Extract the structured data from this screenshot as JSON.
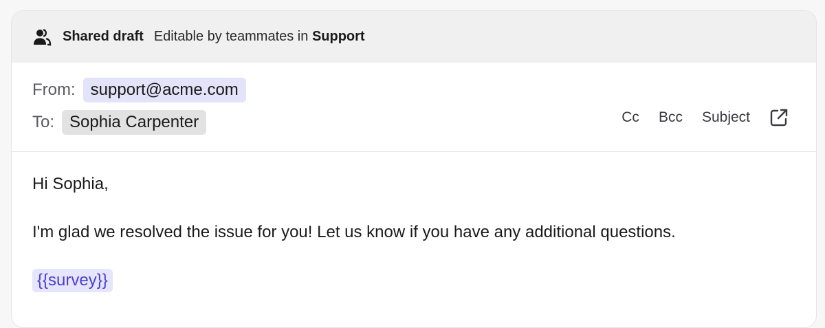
{
  "banner": {
    "title": "Shared draft",
    "description": "Editable by teammates in ",
    "team": "Support"
  },
  "header": {
    "from_label": "From:",
    "from_value": "support@acme.com",
    "to_label": "To:",
    "to_value": "Sophia Carpenter",
    "actions": {
      "cc": "Cc",
      "bcc": "Bcc",
      "subject": "Subject"
    }
  },
  "body": {
    "greeting": "Hi Sophia,",
    "message": "I'm glad we resolved the issue for you! Let us know if you have any additional questions.",
    "token": "{{survey}}"
  },
  "colors": {
    "from_chip_bg": "#e3e3f9",
    "to_chip_bg": "#e2e2e2",
    "token_text": "#4c3fd1",
    "banner_bg": "#f0f0f0"
  }
}
